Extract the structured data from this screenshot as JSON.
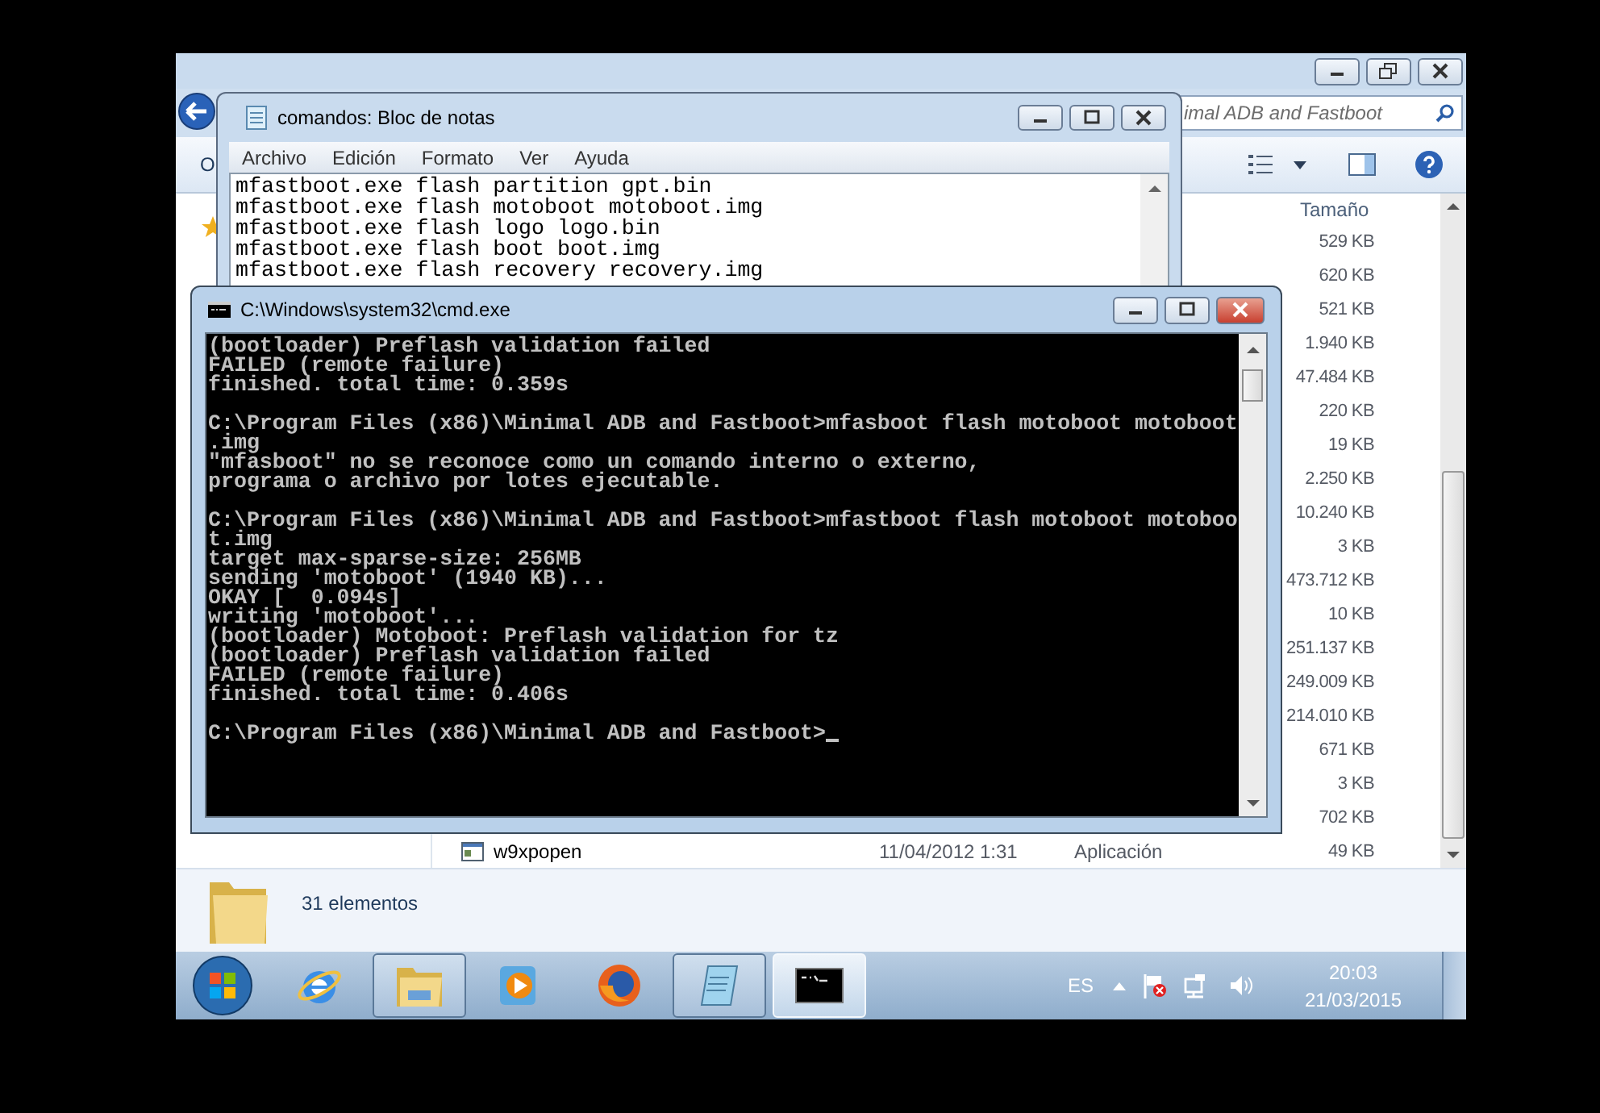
{
  "explorer": {
    "search_text": "imal ADB and Fastboot",
    "toolbar_text": "O",
    "column_header": "Tamaño",
    "rows": [
      {
        "size": "529 KB"
      },
      {
        "size": "620 KB"
      },
      {
        "size": "521 KB"
      },
      {
        "size": "1.940 KB"
      },
      {
        "size": "47.484 KB"
      },
      {
        "size": "220 KB"
      },
      {
        "size": "19 KB"
      },
      {
        "size": "2.250 KB"
      },
      {
        "size": "10.240 KB"
      },
      {
        "size": "3 KB"
      },
      {
        "size": "473.712 KB"
      },
      {
        "size": "10 KB"
      },
      {
        "size": "251.137 KB"
      },
      {
        "size": "249.009 KB"
      },
      {
        "size": "214.010 KB"
      },
      {
        "size": "671 KB"
      },
      {
        "size": "3 KB"
      },
      {
        "size": "702 KB"
      },
      {
        "name": "w9xpopen",
        "date": "11/04/2012 1:31",
        "type": "Aplicación",
        "size": "49 KB"
      }
    ],
    "status": "31 elementos"
  },
  "notepad": {
    "title": "comandos: Bloc de notas",
    "menu": [
      "Archivo",
      "Edición",
      "Formato",
      "Ver",
      "Ayuda"
    ],
    "lines": [
      "mfastboot.exe flash partition gpt.bin",
      "mfastboot.exe flash motoboot motoboot.img",
      "mfastboot.exe flash logo logo.bin",
      "mfastboot.exe flash boot boot.img",
      "mfastboot.exe flash recovery recovery.img"
    ]
  },
  "cmd": {
    "title": "C:\\Windows\\system32\\cmd.exe",
    "cursor": true,
    "blocks": [
      [
        "(bootloader) Preflash validation failed",
        "FAILED (remote failure)",
        "finished. total time: 0.359s"
      ],
      [
        "C:\\Program Files (x86)\\Minimal ADB and Fastboot>mfasboot flash motoboot motoboot",
        ".img",
        "\"mfasboot\" no se reconoce como un comando interno o externo,",
        "programa o archivo por lotes ejecutable."
      ],
      [
        "C:\\Program Files (x86)\\Minimal ADB and Fastboot>mfastboot flash motoboot motoboo",
        "t.img",
        "target max-sparse-size: 256MB",
        "sending 'motoboot' (1940 KB)...",
        "OKAY [  0.094s]",
        "writing 'motoboot'...",
        "(bootloader) Motoboot: Preflash validation for tz",
        "(bootloader) Preflash validation failed",
        "FAILED (remote failure)",
        "finished. total time: 0.406s"
      ],
      [
        "C:\\Program Files (x86)\\Minimal ADB and Fastboot>"
      ]
    ]
  },
  "taskbar": {
    "items": [
      {
        "kind": "browser",
        "running": false,
        "selected": false
      },
      {
        "kind": "explorer",
        "running": true,
        "selected": false
      },
      {
        "kind": "media",
        "running": false,
        "selected": false
      },
      {
        "kind": "firefox",
        "running": false,
        "selected": false
      },
      {
        "kind": "notepad",
        "running": true,
        "selected": false
      },
      {
        "kind": "cmd",
        "running": true,
        "selected": true
      }
    ],
    "language": "ES",
    "time": "20:03",
    "date": "21/03/2015"
  }
}
